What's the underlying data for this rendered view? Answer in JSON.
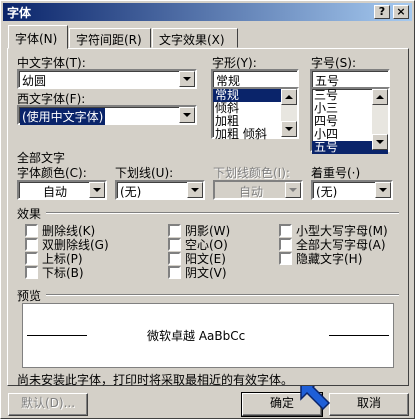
{
  "window": {
    "title": "字体",
    "help_glyph": "?",
    "close_glyph": "×"
  },
  "tabs": [
    {
      "label": "字体(N)",
      "active": true
    },
    {
      "label": "字符间距(R)",
      "active": false
    },
    {
      "label": "文字效果(X)",
      "active": false
    }
  ],
  "font": {
    "chinese_label": "中文字体(T):",
    "chinese_value": "幼圆",
    "western_label": "西文字体(F):",
    "western_value": "(使用中文字体)",
    "style_label": "字形(Y):",
    "style_value": "常规",
    "style_items": [
      "常规",
      "倾斜",
      "加粗",
      "加粗 倾斜"
    ],
    "style_selected": 0,
    "size_label": "字号(S):",
    "size_value": "五号",
    "size_items": [
      "三号",
      "小三",
      "四号",
      "小四",
      "五号"
    ],
    "size_selected": 4
  },
  "all_text": {
    "heading": "全部文字",
    "color_label": "字体颜色(C):",
    "color_value": "自动",
    "underline_label": "下划线(U):",
    "underline_value": "(无)",
    "underline_color_label": "下划线颜色(I):",
    "underline_color_value": "自动",
    "emphasis_label": "着重号(·)",
    "emphasis_value": "(无)"
  },
  "effects": {
    "heading": "效果",
    "items": [
      "删除线(K)",
      "双删除线(G)",
      "上标(P)",
      "下标(B)",
      "阴影(W)",
      "空心(O)",
      "阳文(E)",
      "阴文(V)",
      "小型大写字母(M)",
      "全部大写字母(A)",
      "隐藏文字(H)"
    ]
  },
  "preview": {
    "heading": "预览",
    "sample": "微软卓越 AaBbCc"
  },
  "note": "尚未安装此字体，打印时将采取最相近的有效字体。",
  "buttons": {
    "default": "默认(D)...",
    "ok": "确定",
    "cancel": "取消"
  },
  "colors": {
    "titlebar_start": "#0a246a",
    "titlebar_end": "#a6caf0",
    "selection": "#0a246a",
    "face": "#d4d0c8"
  }
}
